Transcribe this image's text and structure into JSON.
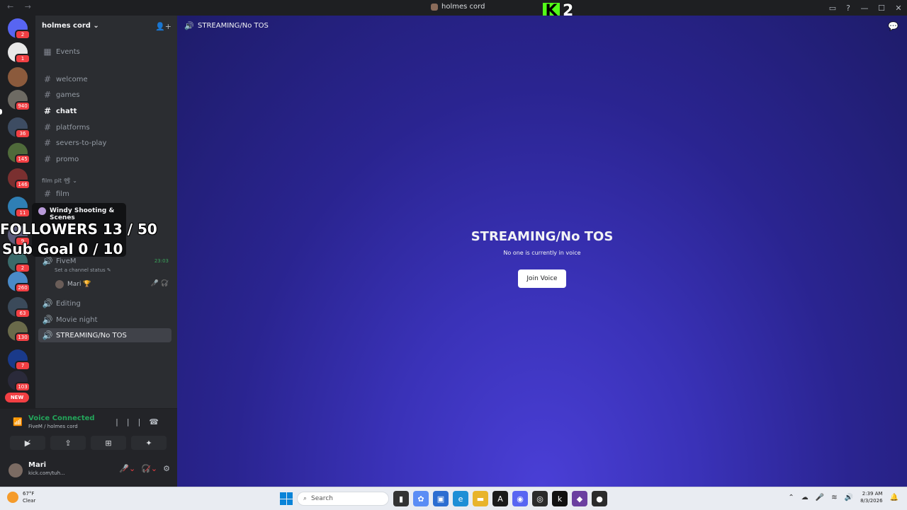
{
  "titlebar": {
    "nav": "←  →",
    "title": "holmes cord",
    "kick_letter": "K",
    "kick_count": "2",
    "icons": [
      "inbox-icon",
      "help-icon"
    ],
    "window": {
      "minimize": "—",
      "maximize": "☐",
      "close": "✕"
    }
  },
  "rail": {
    "badges": [
      "2",
      "1",
      "940",
      "36",
      "145",
      "146",
      "11",
      "9",
      "2",
      "260",
      "63",
      "130",
      "7",
      "103"
    ],
    "new_label": "NEW"
  },
  "server": {
    "name": "holmes cord ⌄"
  },
  "channels": {
    "events": "Events",
    "text": [
      "welcome",
      "games",
      "chatt",
      "platforms",
      "severs-to-play",
      "promo"
    ],
    "category": "film pit 📽 ⌄",
    "film": "film",
    "fivem": "FiveM",
    "fivem_status": "Set a channel status ✎",
    "fivem_timer": "23:03",
    "fivem_user": "Mari 🏆",
    "voice": [
      "Editing",
      "Movie night",
      "STREAMING/No TOS"
    ]
  },
  "tooltip": {
    "title": "Windy Shooting & Scenes"
  },
  "overlay": {
    "followers": "FOLLOWERS 13 / 50",
    "subgoal": "Sub Goal 0 / 10"
  },
  "voice_panel": {
    "status": "Voice Connected",
    "location": "FiveM / holmes cord"
  },
  "user_panel": {
    "name": "Mari",
    "status": "kick.com/tuh..."
  },
  "main": {
    "channel_title": "STREAMING/No TOS",
    "center_title": "STREAMING/No TOS",
    "center_sub": "No one is currently in voice",
    "join_label": "Join Voice"
  },
  "taskbar": {
    "temp": "67°F",
    "weather": "Clear",
    "search_placeholder": "Search",
    "time": "2:39 AM",
    "date": "8/3/2026"
  },
  "colors": {
    "accent_green": "#23a55a",
    "badge_red": "#f23f43",
    "kick_green": "#53fc18",
    "main_gradient": "#3a32b8"
  }
}
